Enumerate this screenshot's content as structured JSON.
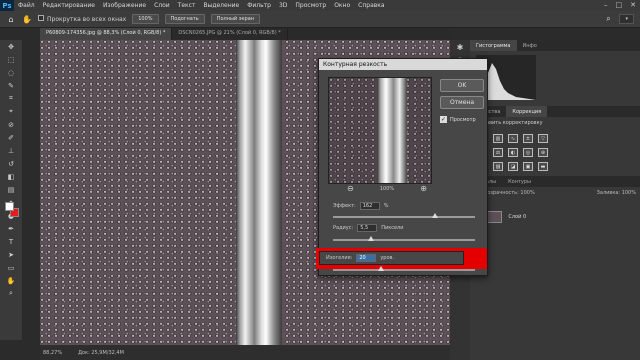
{
  "menu": {
    "logo": "Ps",
    "items": [
      "Файл",
      "Редактирование",
      "Изображение",
      "Слои",
      "Текст",
      "Выделение",
      "Фильтр",
      "3D",
      "Просмотр",
      "Окно",
      "Справка"
    ]
  },
  "options": {
    "scroll_all_label": "Прокрутка во всех окнах",
    "zoom_value": "100%",
    "fit_label": "Подогнать",
    "fullscreen_label": "Полный экран"
  },
  "tabs": [
    {
      "label": "P60809-174356.jpg @ 88,3% (Слой 0, RGB/8) *",
      "active": true
    },
    {
      "label": "DSCN0265.JPG @ 21% (Слой 0, RGB/8) *",
      "active": false
    }
  ],
  "status": {
    "zoom": "88,27%",
    "doc": "Док: 25,9M/32,4M"
  },
  "panels": {
    "top_tabs": [
      "Гистограмма",
      "Инфо"
    ],
    "mid_tabs": [
      "Свойства",
      "Коррекция"
    ],
    "add_label": "Добавить корректировку",
    "bottom_tabs": [
      "Каналы",
      "Контуры"
    ],
    "opacity_label": "Непрозрачность: 100%",
    "fill_label": "Заливка: 100%",
    "layer_name": "Слой 0"
  },
  "dialog": {
    "title": "Контурная резкость",
    "ok_label": "OK",
    "cancel_label": "Отмена",
    "preview_label": "Просмотр",
    "zoom_percent": "100%",
    "amount_label": "Эффект:",
    "amount_value": "162",
    "amount_unit": "%",
    "radius_label": "Радиус:",
    "radius_value": "5,5",
    "radius_unit": "Пиксели",
    "threshold_label": "Изогелия:",
    "threshold_value": "20",
    "threshold_unit": "уров.",
    "amount_fraction": 0.72,
    "radius_fraction": 0.27,
    "threshold_fraction": 0.34
  },
  "colors": {
    "foreground": "#ffffff",
    "background": "#e81a1a",
    "highlight": "#e50000"
  }
}
